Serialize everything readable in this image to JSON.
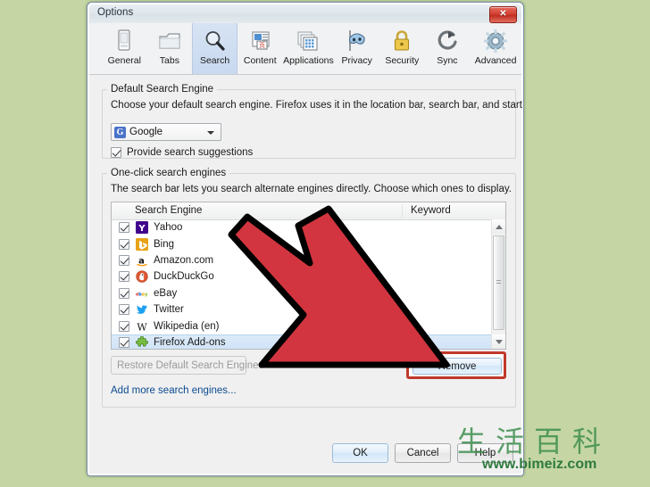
{
  "window": {
    "title": "Options",
    "close_label": "✕"
  },
  "toolbar": {
    "tabs": [
      {
        "label": "General",
        "icon": "general-icon",
        "selected": false
      },
      {
        "label": "Tabs",
        "icon": "tabs-icon",
        "selected": false
      },
      {
        "label": "Search",
        "icon": "search-icon",
        "selected": true
      },
      {
        "label": "Content",
        "icon": "content-icon",
        "selected": false
      },
      {
        "label": "Applications",
        "icon": "applications-icon",
        "selected": false
      },
      {
        "label": "Privacy",
        "icon": "privacy-mask-icon",
        "selected": false
      },
      {
        "label": "Security",
        "icon": "padlock-icon",
        "selected": false
      },
      {
        "label": "Sync",
        "icon": "sync-icon",
        "selected": false
      },
      {
        "label": "Advanced",
        "icon": "gear-icon",
        "selected": false
      }
    ]
  },
  "default_engine_group": {
    "legend": "Default Search Engine",
    "description": "Choose your default search engine. Firefox uses it in the location bar, search bar, and start page.",
    "dropdown": {
      "value": "Google",
      "icon_glyph": "G",
      "icon_color": "#4a73c8"
    },
    "suggestions_checkbox": {
      "label": "Provide search suggestions",
      "checked": true
    }
  },
  "oneclick_group": {
    "legend": "One-click search engines",
    "description": "The search bar lets you search alternate engines directly. Choose which ones to display.",
    "columns": {
      "engine": "Search Engine",
      "keyword": "Keyword"
    },
    "rows": [
      {
        "name": "Yahoo",
        "keyword": "",
        "checked": true,
        "selected": false,
        "icon": "yahoo-icon",
        "icon_color": "#40008c",
        "glyph": "Y"
      },
      {
        "name": "Bing",
        "keyword": "",
        "checked": true,
        "selected": false,
        "icon": "bing-icon",
        "icon_color": "#e8a317",
        "glyph": "b"
      },
      {
        "name": "Amazon.com",
        "keyword": "",
        "checked": true,
        "selected": false,
        "icon": "amazon-icon",
        "icon_color": "#ffffff",
        "glyph": "a"
      },
      {
        "name": "DuckDuckGo",
        "keyword": "",
        "checked": true,
        "selected": false,
        "icon": "duckduckgo-icon",
        "icon_color": "#de5833",
        "glyph": "d"
      },
      {
        "name": "eBay",
        "keyword": "",
        "checked": true,
        "selected": false,
        "icon": "ebay-icon",
        "icon_color": "#86b817",
        "glyph": "e"
      },
      {
        "name": "Twitter",
        "keyword": "",
        "checked": true,
        "selected": false,
        "icon": "twitter-icon",
        "icon_color": "#1da1f2",
        "glyph": "t"
      },
      {
        "name": "Wikipedia (en)",
        "keyword": "",
        "checked": true,
        "selected": false,
        "icon": "wikipedia-icon",
        "icon_color": "#000000",
        "glyph": "W"
      },
      {
        "name": "Firefox Add-ons",
        "keyword": "",
        "checked": true,
        "selected": true,
        "icon": "addons-puzzle-icon",
        "icon_color": "#6aa84f",
        "glyph": "+"
      }
    ],
    "restore_button": "Restore Default Search Engines",
    "restore_button_disabled": true,
    "remove_button": "Remove",
    "remove_button_highlighted": true,
    "add_link": "Add more search engines..."
  },
  "footer": {
    "ok": "OK",
    "cancel": "Cancel",
    "help": "Help"
  },
  "annotation": {
    "arrow_fill": "#d2353f",
    "arrow_stroke": "#000000",
    "highlight_color": "#c0392b"
  },
  "watermark": {
    "cjk_text": "生活百科",
    "url": "www.bimeiz.com"
  },
  "colors": {
    "desktop_background": "#c5d6a4",
    "dialog_background": "#f0f0f0",
    "selection_blue": "#cfe3f7"
  }
}
